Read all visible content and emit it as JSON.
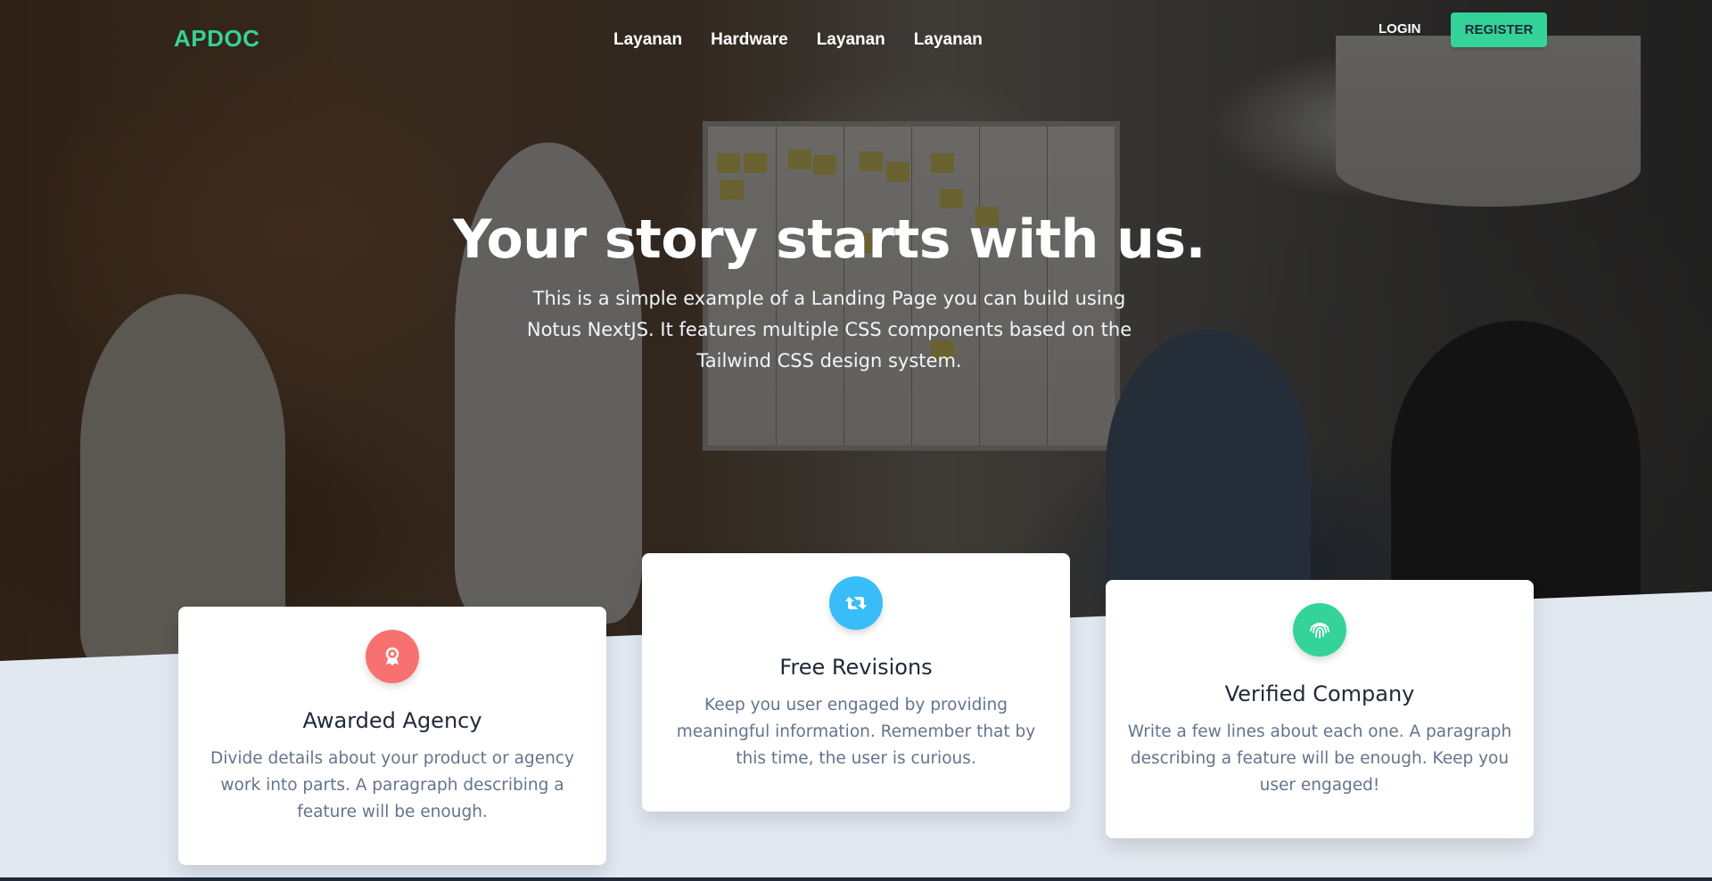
{
  "nav": {
    "brand": "APDOC",
    "links": [
      "Layanan",
      "Hardware",
      "Layanan",
      "Layanan"
    ],
    "login": "LOGIN",
    "register": "REGISTER"
  },
  "hero": {
    "title": "Your story starts with us.",
    "subtitle": "This is a simple example of a Landing Page you can build using Notus NextJS. It features multiple CSS components based on the Tailwind CSS design system."
  },
  "features": [
    {
      "icon": "award-icon",
      "icon_color": "#f87171",
      "title": "Awarded Agency",
      "text": "Divide details about your product or agency work into parts. A paragraph describing a feature will be enough."
    },
    {
      "icon": "retweet-icon",
      "icon_color": "#38bdf8",
      "title": "Free Revisions",
      "text": "Keep you user engaged by providing meaningful information. Remember that by this time, the user is curious."
    },
    {
      "icon": "fingerprint-icon",
      "icon_color": "#34d399",
      "title": "Verified Company",
      "text": "Write a few lines about each one. A paragraph describing a feature will be enough. Keep you user engaged!"
    }
  ],
  "colors": {
    "accent": "#34d399",
    "background": "#e2e8f0",
    "heading": "#1f2937",
    "body_text": "#64748b"
  }
}
